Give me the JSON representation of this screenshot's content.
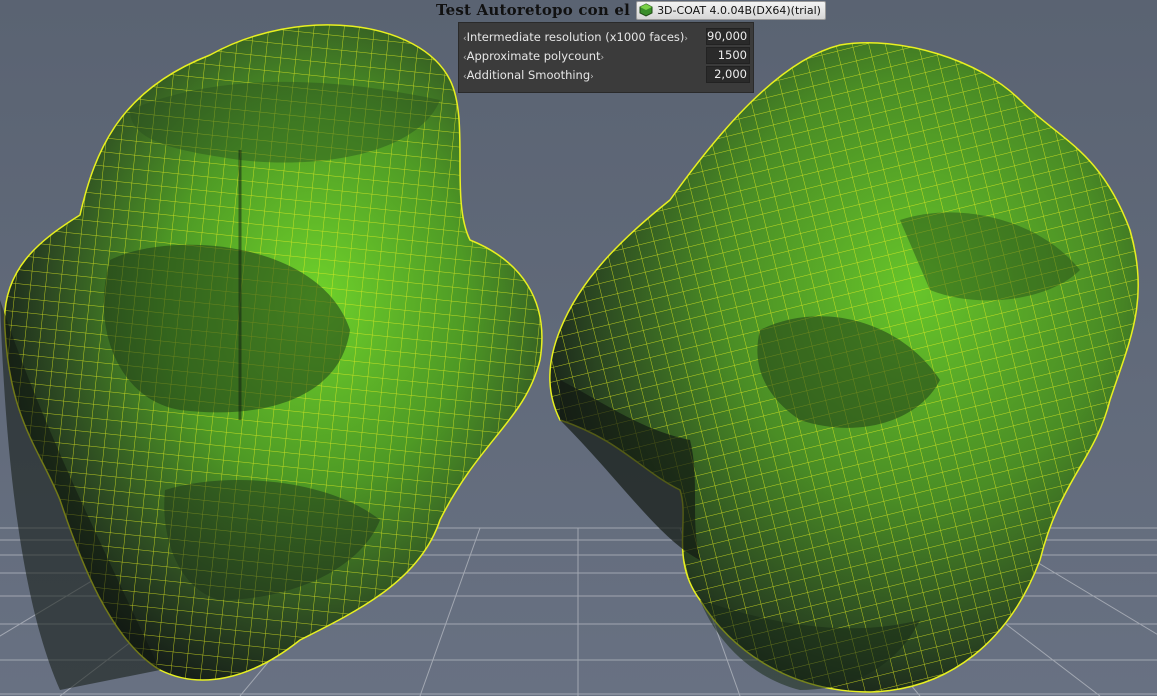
{
  "title": {
    "text": "Test Autoretopo con el",
    "app_name": "3D-COAT 4.0.04B(DX64)(trial)"
  },
  "panel": {
    "rows": [
      {
        "label": "Intermediate resolution (x1000 faces)",
        "value": "90,000"
      },
      {
        "label": "Approximate polycount",
        "value": "1500"
      },
      {
        "label": "Additional Smoothing",
        "value": "2,000"
      }
    ]
  },
  "viewport": {
    "models": [
      "head-front-view",
      "head-side-view"
    ]
  },
  "colors": {
    "background": "#5d6675",
    "mesh_light": "#5db52b",
    "mesh_dark": "#1e2b20",
    "wire": "#e8f020",
    "grid": "#c9ccd2"
  }
}
